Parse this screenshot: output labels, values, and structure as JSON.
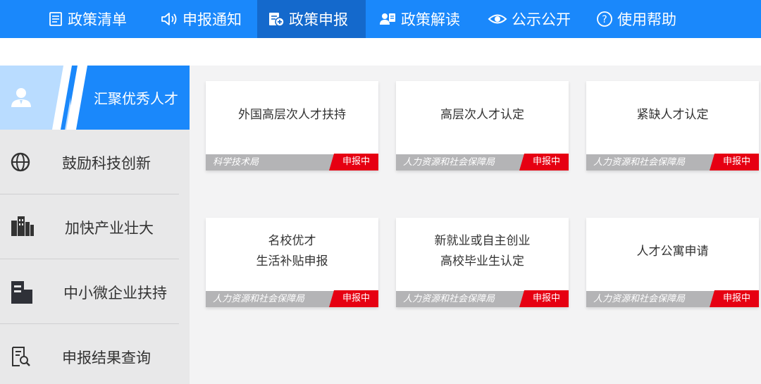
{
  "nav": {
    "items": [
      {
        "label": "政策清单",
        "icon": "list-icon"
      },
      {
        "label": "申报通知",
        "icon": "speaker-icon"
      },
      {
        "label": "政策申报",
        "icon": "form-add-icon"
      },
      {
        "label": "政策解读",
        "icon": "person-card-icon"
      },
      {
        "label": "公示公开",
        "icon": "eye-icon"
      },
      {
        "label": "使用帮助",
        "icon": "question-circle-icon"
      }
    ],
    "active": "政策申报"
  },
  "sidebar": {
    "items": [
      {
        "label": "汇聚优秀人才",
        "icon": "person-icon",
        "active": true
      },
      {
        "label": "鼓励科技创新",
        "icon": "globe-icon"
      },
      {
        "label": "加快产业壮大",
        "icon": "city-buildings-icon"
      },
      {
        "label": "中小微企业扶持",
        "icon": "building-icon"
      },
      {
        "label": "申报结果查询",
        "icon": "document-search-icon"
      }
    ]
  },
  "cards": [
    {
      "title_lines": [
        "外国高层次人才扶持"
      ],
      "dept": "科学技术局",
      "status": "申报中"
    },
    {
      "title_lines": [
        "高层次人才认定"
      ],
      "dept": "人力资源和社会保障局",
      "status": "申报中"
    },
    {
      "title_lines": [
        "紧缺人才认定"
      ],
      "dept": "人力资源和社会保障局",
      "status": "申报中"
    },
    {
      "title_lines": [
        "名校优才",
        "生活补贴申报"
      ],
      "dept": "人力资源和社会保障局",
      "status": "申报中"
    },
    {
      "title_lines": [
        "新就业或自主创业",
        "高校毕业生认定"
      ],
      "dept": "人力资源和社会保障局",
      "status": "申报中"
    },
    {
      "title_lines": [
        "人才公寓申请"
      ],
      "dept": "人力资源和社会保障局",
      "status": "申报中"
    }
  ],
  "colors": {
    "nav_bg": "#1a88fb",
    "nav_active_bg": "#1469cc",
    "badge_red": "#e60012",
    "footer_gray": "#b4b4b6"
  }
}
